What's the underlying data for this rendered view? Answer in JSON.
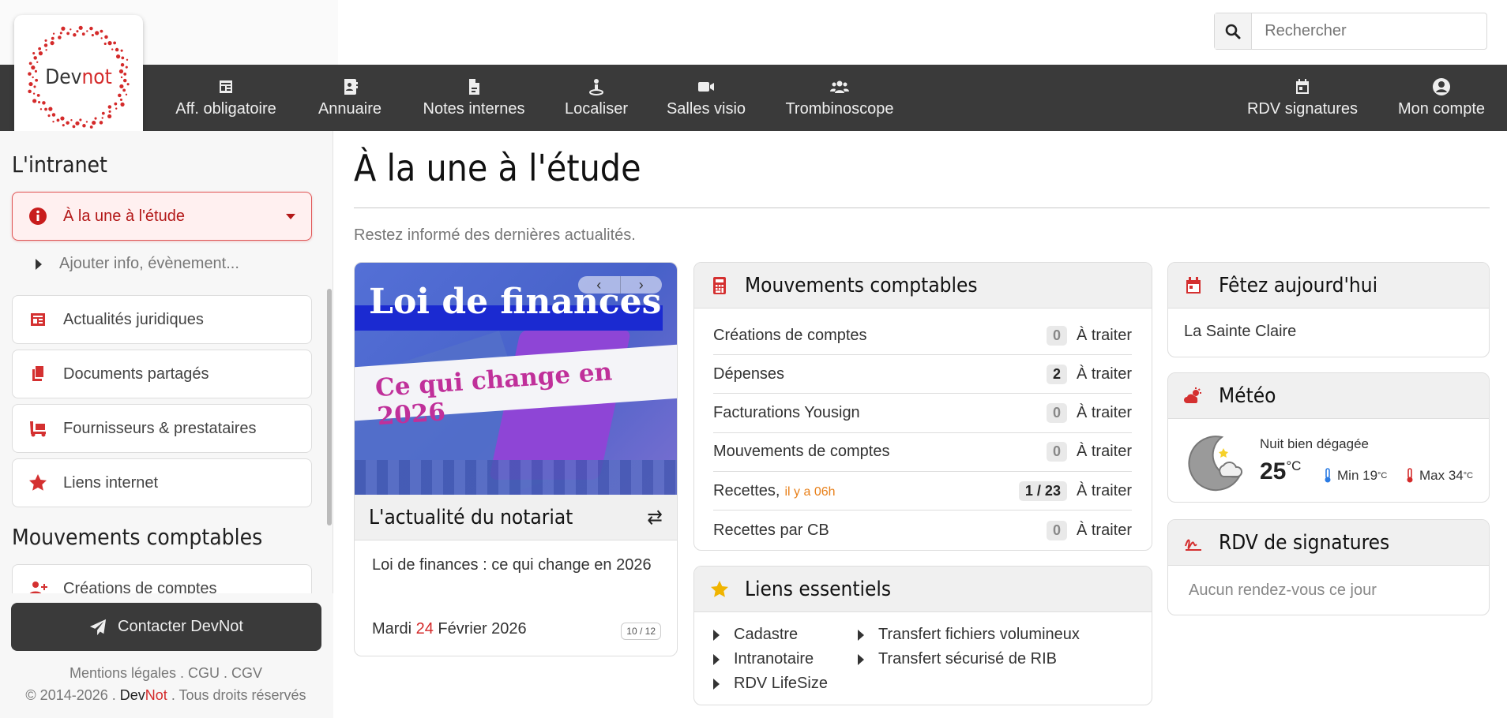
{
  "search": {
    "placeholder": "Rechercher"
  },
  "logo": {
    "prefix": "Dev",
    "suffix": "not"
  },
  "nav": {
    "left": [
      {
        "label": "Aff. obligatoire",
        "icon": "newspaper-icon"
      },
      {
        "label": "Annuaire",
        "icon": "address-book-icon"
      },
      {
        "label": "Notes internes",
        "icon": "file-icon"
      },
      {
        "label": "Localiser",
        "icon": "location-icon"
      },
      {
        "label": "Salles visio",
        "icon": "video-icon"
      },
      {
        "label": "Trombinoscope",
        "icon": "users-icon"
      }
    ],
    "right": [
      {
        "label": "RDV signatures",
        "icon": "calendar-icon"
      },
      {
        "label": "Mon compte",
        "icon": "user-circle-icon"
      }
    ]
  },
  "sidebar": {
    "heading1": "L'intranet",
    "active_item": "À la une à l'étude",
    "sub_item": "Ajouter info, évènement...",
    "items": [
      "Actualités juridiques",
      "Documents partagés",
      "Fournisseurs & prestataires",
      "Liens internet"
    ],
    "heading2": "Mouvements comptables",
    "partial_item": "Créations de comptes",
    "contact": "Contacter DevNot",
    "legal": "Mentions légales . CGU . CGV",
    "copyright_prefix": "© 2014-2026 . ",
    "copyright_dev": "Dev",
    "copyright_not": "Not",
    "copyright_suffix": " . Tous droits réservés"
  },
  "main": {
    "title": "À la une à l'étude",
    "subtitle": "Restez informé des dernières actualités."
  },
  "news": {
    "image_title": "Loi de finances",
    "image_subtitle": "Ce qui change en 2026",
    "prev": "‹",
    "next": "›",
    "header": "L'actualité du notariat",
    "swap": "⇄",
    "text": "Loi de finances : ce qui change en 2026",
    "date_weekday": "Mardi",
    "date_day": "24",
    "date_rest": "Février 2026",
    "pager": "10 / 12"
  },
  "mouvements": {
    "header": "Mouvements comptables",
    "rows": [
      {
        "label": "Créations de comptes",
        "ago": "",
        "count": "0",
        "status": "À traiter"
      },
      {
        "label": "Dépenses",
        "ago": "",
        "count": "2",
        "status": "À traiter"
      },
      {
        "label": "Facturations Yousign",
        "ago": "",
        "count": "0",
        "status": "À traiter"
      },
      {
        "label": "Mouvements de comptes",
        "ago": "",
        "count": "0",
        "status": "À traiter"
      },
      {
        "label": "Recettes,",
        "ago": "il y a 06h",
        "count": "1 / 23",
        "status": "À traiter"
      },
      {
        "label": "Recettes par CB",
        "ago": "",
        "count": "0",
        "status": "À traiter"
      }
    ]
  },
  "liens": {
    "header": "Liens essentiels",
    "col1": [
      "Cadastre",
      "Intranotaire",
      "RDV LifeSize"
    ],
    "col2": [
      "Transfert fichiers volumineux",
      "Transfert sécurisé de RIB"
    ]
  },
  "fete": {
    "header": "Fêtez aujourd'hui",
    "saint": "La Sainte Claire"
  },
  "meteo": {
    "header": "Météo",
    "desc": "Nuit bien dégagée",
    "temp": "25",
    "unit": "°C",
    "min_label": "Min 19",
    "max_label": "Max 34",
    "min_unit": "°C",
    "max_unit": "°C"
  },
  "rdv": {
    "header": "RDV de signatures",
    "empty": "Aucun rendez-vous ce jour"
  },
  "colors": {
    "brand_red": "#d42a2a",
    "nav_bg": "#3a3a3a",
    "orange": "#e8801a"
  }
}
